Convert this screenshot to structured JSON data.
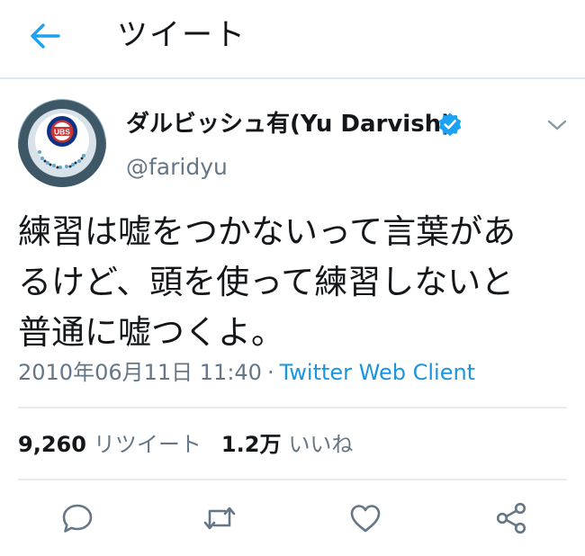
{
  "header": {
    "title": "ツイート",
    "back_icon": "arrow-left-icon",
    "accent_color": "#1da1f2"
  },
  "author": {
    "name": "ダルビッシュ有(Yu Darvish)",
    "handle": "@faridyu",
    "verified_icon": "verified-badge-icon",
    "avatar_logo_text": "UBS",
    "menu_icon": "chevron-down-icon"
  },
  "tweet": {
    "text_lines": [
      "練習は嘘をつかないって言葉があ",
      "るけど、頭を使って練習しないと",
      "普通に嘘つくよ。"
    ],
    "timestamp": "2010年06月11日 11:40",
    "separator": "·",
    "source": "Twitter Web Client",
    "link_color": "#1b95e0"
  },
  "stats": {
    "retweets": {
      "count": "9,260",
      "label": "リツイート"
    },
    "likes": {
      "count": "1.2万",
      "label": "いいね"
    }
  },
  "actions": [
    {
      "name": "reply-icon"
    },
    {
      "name": "retweet-icon"
    },
    {
      "name": "like-icon"
    },
    {
      "name": "share-icon"
    }
  ]
}
